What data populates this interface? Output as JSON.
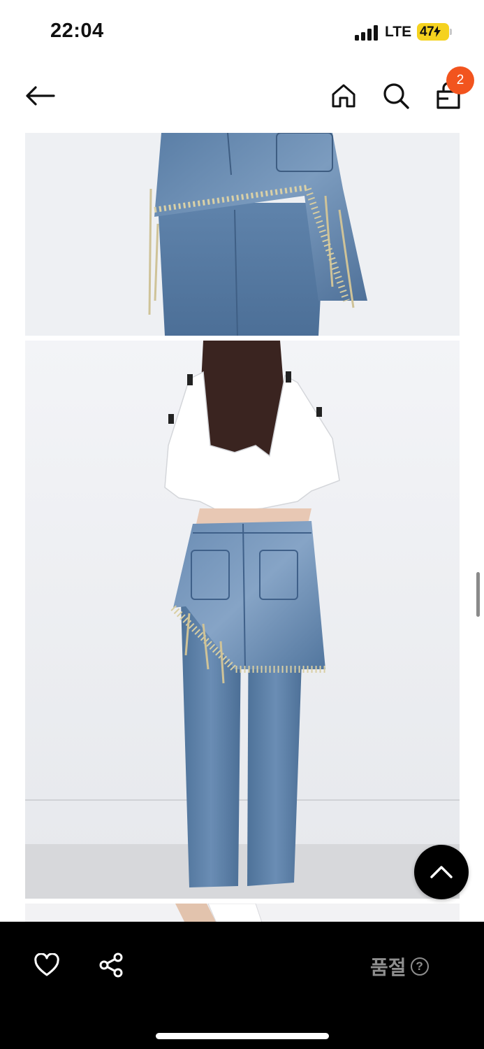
{
  "status_bar": {
    "time": "22:04",
    "network": "LTE",
    "battery": "47",
    "icons": [
      "signal-bars-icon",
      "battery-charging-icon"
    ]
  },
  "header": {
    "icons": [
      "back-arrow-icon",
      "home-icon",
      "search-icon",
      "shopping-bag-icon"
    ],
    "cart_count": "2"
  },
  "product_images": [
    "skirt-close-up-photo",
    "model-back-view-photo",
    "model-photo-partial"
  ],
  "scroll_to_top": {
    "icon": "chevron-up-icon"
  },
  "bottom_bar": {
    "icons": [
      "heart-icon",
      "share-icon",
      "help-icon"
    ],
    "status_label": "품절",
    "help_symbol": "?"
  },
  "colors": {
    "badge": "#f2541e",
    "battery": "#f5d21f",
    "bottom_bar": "#000000",
    "muted_text": "#8e8e8e"
  }
}
